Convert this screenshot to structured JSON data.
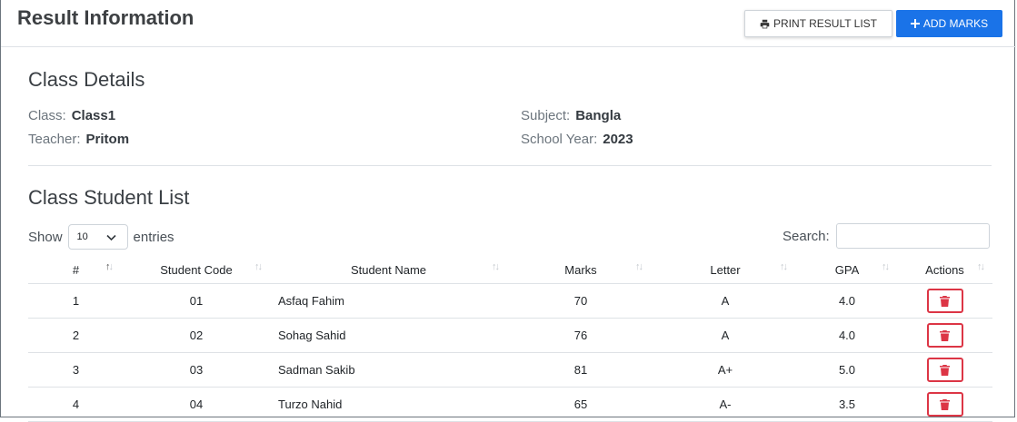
{
  "header": {
    "title": "Result Information",
    "print_label": "PRINT RESULT LIST",
    "add_label": "ADD MARKS"
  },
  "class_details": {
    "heading": "Class Details",
    "class_label": "Class:",
    "class_value": "Class1",
    "teacher_label": "Teacher:",
    "teacher_value": "Pritom",
    "subject_label": "Subject:",
    "subject_value": "Bangla",
    "year_label": "School Year:",
    "year_value": "2023"
  },
  "student_list": {
    "heading": "Class Student List",
    "show_label": "Show",
    "entries_value": "10",
    "entries_label": "entries",
    "search_label": "Search:",
    "columns": [
      "#",
      "Student Code",
      "Student Name",
      "Marks",
      "Letter",
      "GPA",
      "Actions"
    ],
    "rows": [
      {
        "no": "1",
        "code": "01",
        "name": "Asfaq Fahim",
        "marks": "70",
        "letter": "A",
        "gpa": "4.0"
      },
      {
        "no": "2",
        "code": "02",
        "name": "Sohag Sahid",
        "marks": "76",
        "letter": "A",
        "gpa": "4.0"
      },
      {
        "no": "3",
        "code": "03",
        "name": "Sadman Sakib",
        "marks": "81",
        "letter": "A+",
        "gpa": "5.0"
      },
      {
        "no": "4",
        "code": "04",
        "name": "Turzo Nahid",
        "marks": "65",
        "letter": "A-",
        "gpa": "3.5"
      }
    ]
  },
  "icons": {
    "print": "printer-icon",
    "add": "plus-icon",
    "delete": "trash-icon",
    "select": "chevron-down-icon",
    "sort": "sort-arrows-icon"
  },
  "colors": {
    "primary": "#1a73e8",
    "danger": "#dc3545"
  }
}
